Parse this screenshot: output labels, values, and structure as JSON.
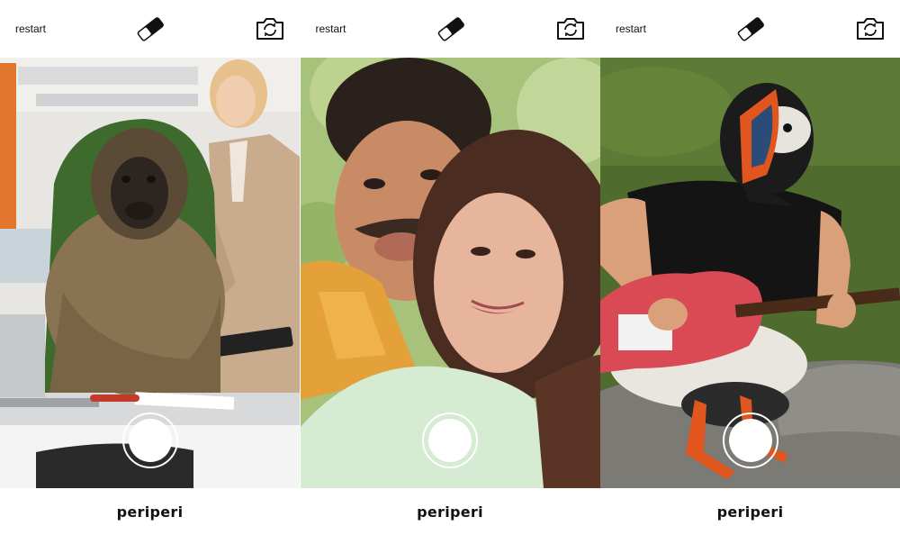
{
  "brand": "periperi",
  "screens": [
    {
      "restart_label": "restart",
      "scene": "monkey-office"
    },
    {
      "restart_label": "restart",
      "scene": "couple-selfie"
    },
    {
      "restart_label": "restart",
      "scene": "puffin-guitarist"
    }
  ],
  "icons": {
    "eraser": "eraser-icon",
    "camera_switch": "camera-switch-icon",
    "shutter": "shutter-button"
  },
  "colors": {
    "chrome": "#ffffff",
    "text": "#111111"
  }
}
